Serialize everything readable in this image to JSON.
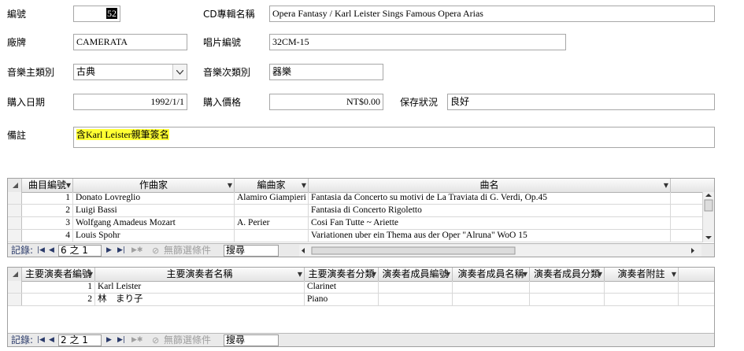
{
  "form": {
    "id_label": "編號",
    "id_value": "52",
    "album_label": "CD專輯名稱",
    "album_value": "Opera Fantasy / Karl Leister Sings Famous Opera Arias",
    "label_label": "廠牌",
    "label_value": "CAMERATA",
    "catalog_label": "唱片編號",
    "catalog_value": "32CM-15",
    "genre_label": "音樂主類別",
    "genre_value": "古典",
    "subgenre_label": "音樂次類別",
    "subgenre_value": "器樂",
    "date_label": "購入日期",
    "date_value": "1992/1/1",
    "price_label": "購入價格",
    "price_value": "NT$0.00",
    "condition_label": "保存狀況",
    "condition_value": "良好",
    "notes_label": "備註",
    "notes_value": "含Karl Leister親筆簽名"
  },
  "tracks": {
    "headers": [
      "曲目編號",
      "作曲家",
      "編曲家",
      "曲名"
    ],
    "rows": [
      [
        "1",
        "Donato Lovreglio",
        "Alamiro Giampieri",
        "Fantasia da Concerto su motivi de La Traviata di G. Verdi, Op.45"
      ],
      [
        "2",
        "Luigi Bassi",
        "",
        "Fantasia di Concerto Rigoletto"
      ],
      [
        "3",
        "Wolfgang Amadeus Mozart",
        "A. Perier",
        "Cosi Fan Tutte ~ Ariette"
      ],
      [
        "4",
        "Louis Spohr",
        "",
        "Variationen uber ein Thema aus der Oper \"Alruna\" WoO 15"
      ]
    ],
    "nav": {
      "record_label": "記錄:",
      "position": "6 之 1",
      "filter_label": "無篩選條件",
      "search_placeholder": "搜尋"
    }
  },
  "performers": {
    "headers": [
      "主要演奏者編號",
      "主要演奏者名稱",
      "主要演奏者分類",
      "演奏者成員編號",
      "演奏者成員名稱",
      "演奏者成員分類",
      "演奏者附註"
    ],
    "rows": [
      [
        "1",
        "Karl Leister",
        "Clarinet",
        "",
        "",
        "",
        ""
      ],
      [
        "2",
        "林　まり子",
        "Piano",
        "",
        "",
        "",
        ""
      ]
    ],
    "nav": {
      "record_label": "記錄:",
      "position": "2 之 1",
      "filter_label": "無篩選條件",
      "search_placeholder": "搜尋"
    }
  },
  "colors": {
    "highlight": "#ffff33",
    "border": "#a7a7a7",
    "nav_bg": "#eaeaea"
  }
}
